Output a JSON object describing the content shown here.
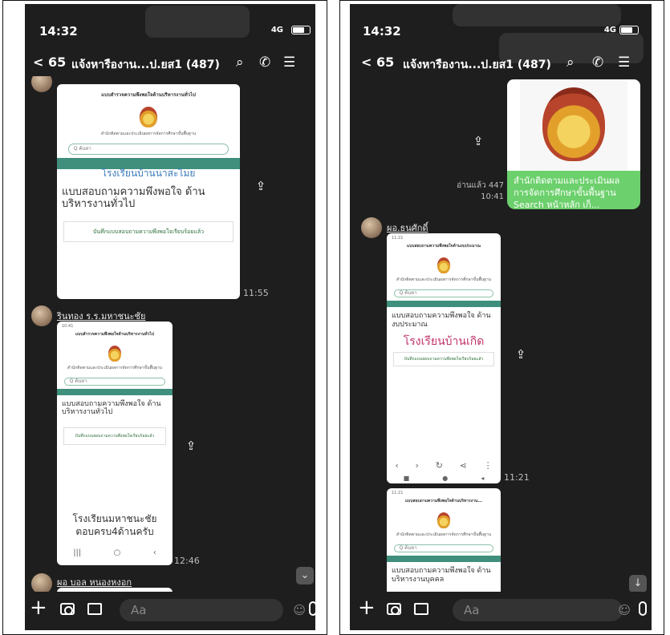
{
  "left": {
    "status": {
      "time": "14:32",
      "signal": "4G"
    },
    "chat_title": {
      "back": "65",
      "title": "แจ้งหารืองาน...ป.ยส1 (487)"
    },
    "messages": [
      {
        "sender": "",
        "shot_header": "แบบสำรวจความพึงพอใจด้านบริหารงานทั่วไป",
        "shot_sub": "สำนักติดตามและประเมินผลการจัดการศึกษาขั้นพื้นฐาน",
        "search_placeholder": "ค้นหา",
        "overlay_school": "โรงเรียนบ้านนาสะไมย",
        "form_title": "แบบสอบถามความพึงพอใจ ด้านบริหารงานทั่วไป",
        "saved_text": "บันทึกแบบสอบถามความพึงพอใจเรียบร้อยแล้ว",
        "time": "11:55"
      },
      {
        "sender": "รินทอง ร.ร.มหาชนะชัย",
        "shot_header": "แบบสำรวจความพึงพอใจด้านบริหารงานทั่วไป",
        "shot_sub": "สำนักติดตามและประเมินผลการจัดการศึกษาขั้นพื้นฐาน",
        "search_placeholder": "ค้นหา",
        "form_title": "แบบสอบถามความพึงพอใจ ด้านบริหารงานทั่วไป",
        "saved_text": "บันทึกแบบสอบถามความพึงพอใจเรียบร้อยแล้ว",
        "caption": "โรงเรียนมหาชนะชัย ตอบครบ4ด้านครับ",
        "time": "12:46"
      },
      {
        "sender": "ผอ บอล หนองหงอก"
      }
    ],
    "input_placeholder": "Aa"
  },
  "right": {
    "status": {
      "time": "14:32",
      "signal": "4G"
    },
    "chat_title": {
      "back": "65",
      "title": "แจ้งหารืองาน...ป.ยส1 (487)"
    },
    "link_message": {
      "read_label": "อ่านแล้ว 447",
      "time": "10:41",
      "text": "สำนักติดตามและประเมินผลการจัดการศึกษาขั้นพื้นฐาน Search หน้าหลัก เก็..."
    },
    "messages": [
      {
        "sender": "ผอ.ธนศักดิ์",
        "shot_header": "แบบสอบถามความพึงพอใจด้านงบประมาณ",
        "shot_sub": "สำนักติดตามและประเมินผลการจัดการศึกษาขั้นพื้นฐาน",
        "search_placeholder": "ค้นหา",
        "form_title": "แบบสอบถามความพึงพอใจ ด้านงบประมาณ",
        "overlay_school": "โรงเรียนบ้านเกิด",
        "saved_text": "บันทึกแบบสอบถามความพึงพอใจเรียบร้อยแล้ว",
        "time": "11:21"
      },
      {
        "shot_header": "แบบสอบถามความพึงพอใจด้านบริหารงาน...",
        "shot_sub": "สำนักติดตามและประเมินผลการจัดการศึกษาขั้นพื้นฐาน",
        "search_placeholder": "ค้นหา",
        "form_title": "แบบสอบถามความพึงพอใจ ด้านบริหารงานบุคคล"
      }
    ],
    "input_placeholder": "Aa"
  },
  "colors": {
    "accent_green": "#6cd06c",
    "teal": "#3f8f7c",
    "chat_bg": "#1e1e1e"
  },
  "icons": [
    "search-icon",
    "phone-icon",
    "menu-icon",
    "plus-icon",
    "camera-icon",
    "gallery-icon",
    "emoji-icon",
    "mic-icon",
    "share-icon",
    "down-arrow-icon"
  ]
}
